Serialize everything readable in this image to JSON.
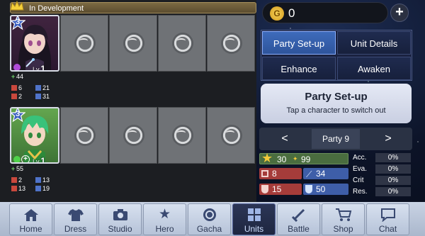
{
  "header": {
    "title": "In Development"
  },
  "party": [
    {
      "rank": "3",
      "level_prefix": "Lv.",
      "level": "1",
      "hp": "44",
      "atk": "6",
      "mag": "21",
      "def": "2",
      "res": "31"
    },
    {
      "rank": "3",
      "level_prefix": "Lv.",
      "level": "1",
      "hp": "55",
      "atk": "2",
      "mag": "13",
      "def": "13",
      "res": "19"
    }
  ],
  "currency": {
    "gold": "0",
    "coin_letter": "G",
    "add_label": "+"
  },
  "menu": {
    "party_setup": "Party Set-up",
    "unit_details": "Unit Details",
    "enhance": "Enhance",
    "awaken": "Awaken"
  },
  "info": {
    "title": "Party Set-up",
    "subtitle": "Tap a character to switch out"
  },
  "pager": {
    "prev": "<",
    "name": "Party 9",
    "next": ">"
  },
  "party_stats": {
    "star": "30",
    "power": "99",
    "atk": "8",
    "mag": "34",
    "def": "15",
    "res": "50",
    "acc_label": "Acc.",
    "acc": "0%",
    "eva_label": "Eva.",
    "eva": "0%",
    "crit_label": "Crit",
    "crit": "0%",
    "res_label": "Res.",
    "resist": "0%"
  },
  "nav": [
    {
      "label": "Home",
      "icon": "home-icon"
    },
    {
      "label": "Dress",
      "icon": "shirt-icon"
    },
    {
      "label": "Studio",
      "icon": "camera-icon"
    },
    {
      "label": "Hero",
      "icon": "star-icon"
    },
    {
      "label": "Gacha",
      "icon": "orb-icon"
    },
    {
      "label": "Units",
      "icon": "grid-icon"
    },
    {
      "label": "Battle",
      "icon": "sword-icon"
    },
    {
      "label": "Shop",
      "icon": "cart-icon"
    },
    {
      "label": "Chat",
      "icon": "chat-icon"
    }
  ],
  "colors": {
    "active_tab": "#1e2640",
    "active_button": "#3e6bbb",
    "gold": "#f6d35a"
  }
}
